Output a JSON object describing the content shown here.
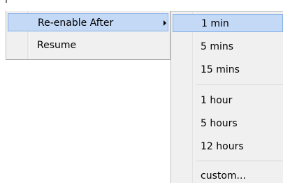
{
  "main_menu": {
    "items": [
      {
        "label": "Re-enable After",
        "highlighted": true,
        "has_submenu": true
      },
      {
        "label": "Resume",
        "highlighted": false,
        "has_submenu": false
      }
    ]
  },
  "submenu": {
    "groups": [
      [
        {
          "label": "1 min",
          "highlighted": true
        },
        {
          "label": "5 mins",
          "highlighted": false
        },
        {
          "label": "15 mins",
          "highlighted": false
        }
      ],
      [
        {
          "label": "1 hour",
          "highlighted": false
        },
        {
          "label": "5 hours",
          "highlighted": false
        },
        {
          "label": "12 hours",
          "highlighted": false
        }
      ],
      [
        {
          "label": "custom...",
          "highlighted": false
        }
      ]
    ]
  },
  "colors": {
    "highlight_fill": "#c4d9f6",
    "highlight_border": "#86b0e8",
    "menu_background": "#f0f0f0"
  },
  "icons": {
    "submenu_arrow": "chevron-right-icon"
  }
}
